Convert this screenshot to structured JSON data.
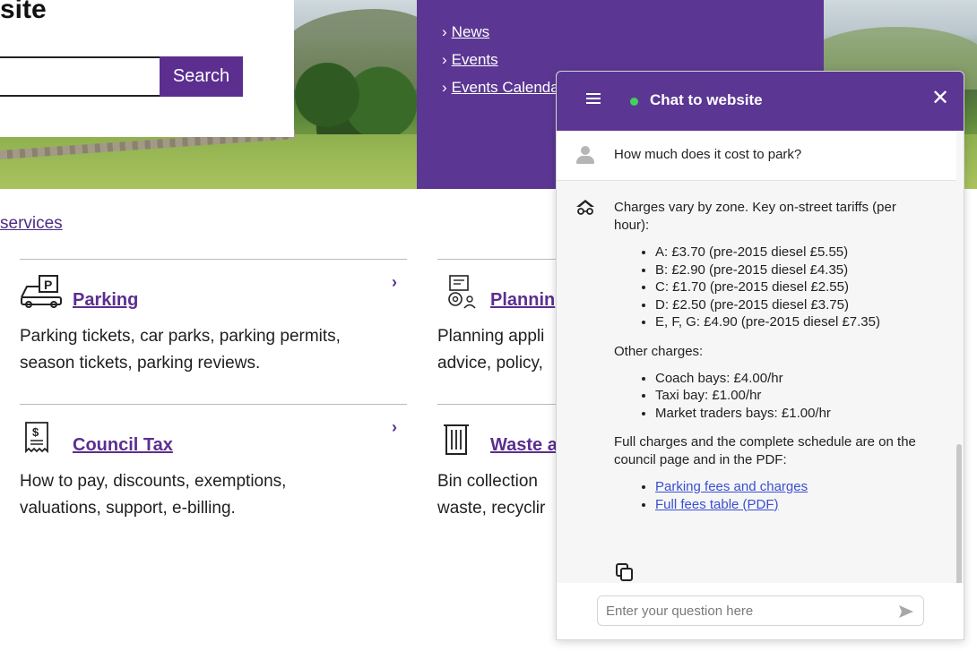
{
  "header": {
    "site_title": "site",
    "search_button": "Search"
  },
  "quick_links": [
    {
      "chevron": "›",
      "label": "News"
    },
    {
      "chevron": "›",
      "label": "Events"
    },
    {
      "chevron": "›",
      "label": "Events Calenda"
    }
  ],
  "services_link": "services",
  "services": [
    {
      "title": "Parking",
      "desc_lines": [
        "Parking tickets, car parks, parking permits,",
        "season tickets, parking reviews."
      ],
      "icon": "parking-car-icon",
      "arrow": "›"
    },
    {
      "title": "Plannin",
      "desc_lines": [
        "Planning appli",
        "advice, policy,"
      ],
      "icon": "planning-icon"
    },
    {
      "title": "Council Tax",
      "desc_lines": [
        "How to pay, discounts, exemptions,",
        "valuations, support, e-billing."
      ],
      "icon": "receipt-icon",
      "arrow": "›"
    },
    {
      "title": "Waste a",
      "desc_lines": [
        "Bin collection",
        "waste, recyclir"
      ],
      "icon": "bin-icon"
    }
  ],
  "chat": {
    "title": "Chat to website",
    "close": "✕",
    "user_message": "How much does it cost to park?",
    "bot_intro": "Charges vary by zone. Key on-street tariffs (per hour):",
    "tariffs": [
      "A: £3.70 (pre-2015 diesel £5.55)",
      "B: £2.90 (pre-2015 diesel £4.35)",
      "C: £1.70 (pre-2015 diesel £2.55)",
      "D: £2.50 (pre-2015 diesel £3.75)",
      "E, F, G: £4.90 (pre-2015 diesel £7.35)"
    ],
    "other_heading": "Other charges:",
    "other_charges": [
      "Coach bays: £4.00/hr",
      "Taxi bay: £1.00/hr",
      "Market traders bays: £1.00/hr"
    ],
    "full_charges_text": "Full charges and the complete schedule are on the council page and in the PDF:",
    "links": [
      "Parking fees and charges",
      "Full fees table (PDF)"
    ],
    "input_placeholder": "Enter your question here"
  }
}
